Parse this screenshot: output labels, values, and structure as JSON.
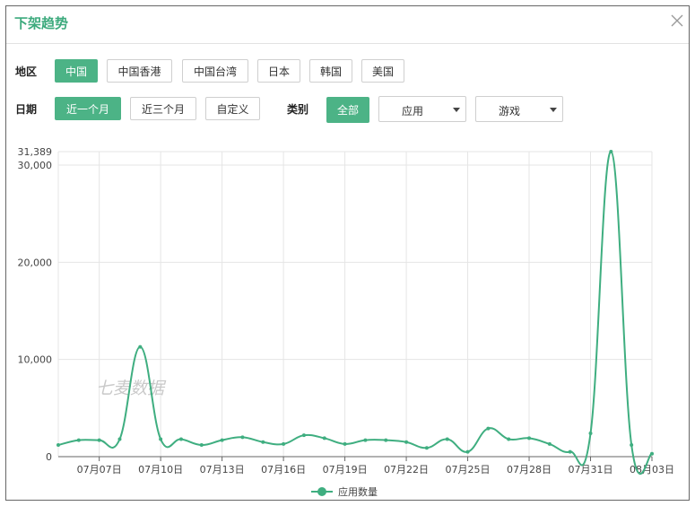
{
  "dialog": {
    "title": "下架趋势",
    "close_icon": "close-icon"
  },
  "filters": {
    "region_label": "地区",
    "regions": [
      {
        "label": "中国",
        "active": true
      },
      {
        "label": "中国香港",
        "active": false
      },
      {
        "label": "中国台湾",
        "active": false
      },
      {
        "label": "日本",
        "active": false
      },
      {
        "label": "韩国",
        "active": false
      },
      {
        "label": "美国",
        "active": false
      }
    ],
    "date_label": "日期",
    "dates": [
      {
        "label": "近一个月",
        "active": true
      },
      {
        "label": "近三个月",
        "active": false
      },
      {
        "label": "自定义",
        "active": false
      }
    ],
    "category_label": "类别",
    "category_all": "全部",
    "select_app": "应用",
    "select_game": "游戏"
  },
  "colors": {
    "accent": "#4cb386",
    "title": "#3daa7d",
    "line": "#3fae80"
  },
  "watermark": "七麦数据",
  "chart_data": {
    "type": "line",
    "x": [
      "07月05日",
      "07月06日",
      "07月07日",
      "07月08日",
      "07月09日",
      "07月10日",
      "07月11日",
      "07月12日",
      "07月13日",
      "07月14日",
      "07月15日",
      "07月16日",
      "07月17日",
      "07月18日",
      "07月19日",
      "07月20日",
      "07月21日",
      "07月22日",
      "07月23日",
      "07月24日",
      "07月25日",
      "07月26日",
      "07月27日",
      "07月28日",
      "07月29日",
      "07月30日",
      "07月31日",
      "08月01日",
      "08月02日",
      "08月03日"
    ],
    "xticks": [
      "07月07日",
      "07月10日",
      "07月13日",
      "07月16日",
      "07月19日",
      "07月22日",
      "07月25日",
      "07月28日",
      "07月31日",
      "08月03日"
    ],
    "series": [
      {
        "name": "应用数量",
        "values": [
          1200,
          1700,
          1700,
          1800,
          11300,
          1800,
          1800,
          1200,
          1700,
          2000,
          1500,
          1300,
          2200,
          1900,
          1300,
          1700,
          1700,
          1500,
          900,
          1800,
          500,
          2900,
          1800,
          1900,
          1300,
          500,
          2400,
          31389,
          1200,
          300
        ]
      }
    ],
    "yticks": [
      "0",
      "10,000",
      "20,000",
      "30,000",
      "31,389"
    ],
    "ylim": [
      0,
      31389
    ],
    "grid": true,
    "legend": "bottom-center"
  }
}
